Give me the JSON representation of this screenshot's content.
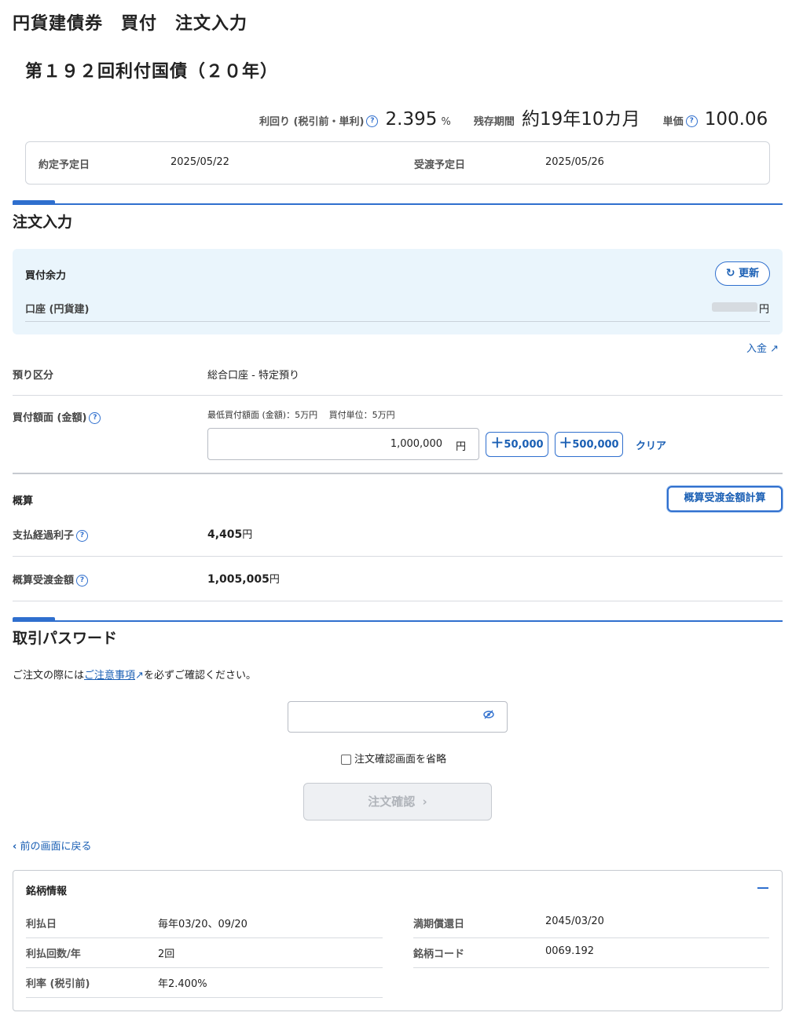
{
  "page_title": "円貨建債券　買付　注文入力",
  "bond_name": "第１９２回利付国債（２０年）",
  "stats": {
    "yield_label": "利回り (税引前・単利)",
    "yield_value": "2.395",
    "yield_unit": "%",
    "term_label": "残存期間",
    "term_value": "約19年10カ月",
    "price_label": "単価",
    "price_value": "100.06"
  },
  "dates": {
    "contract_label": "約定予定日",
    "contract_value": "2025/05/22",
    "delivery_label": "受渡予定日",
    "delivery_value": "2025/05/26"
  },
  "order_section": {
    "title": "注文入力",
    "balance_title": "買付余力",
    "refresh_label": "更新",
    "account_label": "口座 (円貨建)",
    "account_unit": "円",
    "deposit_link": "入金",
    "custody_label": "預り区分",
    "custody_value": "総合口座 - 特定預り",
    "amount_label": "買付額面 (金額)",
    "amount_hint": "最低買付額面 (金額)：5万円　 買付単位：5万円",
    "amount_value": "1,000,000",
    "amount_unit": "円",
    "add_50000": "50,000",
    "add_500000": "500,000",
    "clear_label": "クリア"
  },
  "estimate": {
    "title": "概算",
    "calc_button": "概算受渡金額計算",
    "interest_label": "支払経過利子",
    "interest_value": "4,405",
    "interest_unit": "円",
    "total_label": "概算受渡金額",
    "total_value": "1,005,005",
    "total_unit": "円"
  },
  "password_section": {
    "title": "取引パスワード",
    "notice_before": "ご注文の際には",
    "notice_link": "ご注意事項",
    "notice_after": "を必ずご確認ください。",
    "skip_confirm_label": "注文確認画面を省略",
    "confirm_button": "注文確認",
    "back_link": "前の画面に戻る"
  },
  "bond_info": {
    "title": "銘柄情報",
    "rows_left": [
      {
        "label": "利払日",
        "value": "毎年03/20、09/20"
      },
      {
        "label": "利払回数/年",
        "value": "2回"
      },
      {
        "label": "利率 (税引前)",
        "value": "年2.400%"
      }
    ],
    "rows_right": [
      {
        "label": "満期償還日",
        "value": "2045/03/20"
      },
      {
        "label": "銘柄コード",
        "value": "0069.192"
      }
    ]
  },
  "colors": {
    "accent": "#2f6fce",
    "link": "#1a5fb4",
    "balance_bg": "#eaf5fc"
  }
}
